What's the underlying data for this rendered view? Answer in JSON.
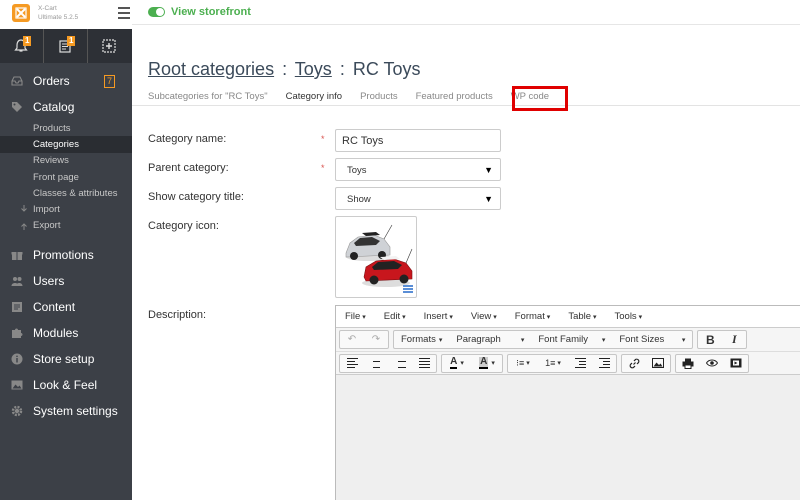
{
  "brand": {
    "line1": "X-Cart",
    "line2": "Ultimate 5.2.5"
  },
  "iconbar": {
    "notifications_badge": "1",
    "orders_badge": "1"
  },
  "topbar": {
    "storefront_label": "View storefront"
  },
  "sidebar": {
    "orders": {
      "label": "Orders",
      "count": "7"
    },
    "catalog": {
      "label": "Catalog"
    },
    "catalog_items": [
      "Products",
      "Categories",
      "Reviews",
      "Front page",
      "Classes & attributes",
      "Import",
      "Export"
    ],
    "sections": [
      "Promotions",
      "Users",
      "Content",
      "Modules",
      "Store setup",
      "Look & Feel",
      "System settings"
    ]
  },
  "breadcrumb": {
    "root": "Root categories",
    "sep1": ":",
    "toys": "Toys",
    "sep2": ":",
    "current": "RC Toys"
  },
  "tabs": [
    "Subcategories for \"RC Toys\"",
    "Category info",
    "Products",
    "Featured products",
    "WP code"
  ],
  "form": {
    "category_name_label": "Category name:",
    "category_name_value": "RC Toys",
    "required_mark": "*",
    "parent_category_label": "Parent category:",
    "parent_category_value": "Toys",
    "show_title_label": "Show category title:",
    "show_title_value": "Show",
    "category_icon_label": "Category icon:",
    "description_label": "Description:"
  },
  "editor": {
    "menu": [
      "File",
      "Edit",
      "Insert",
      "View",
      "Format",
      "Table",
      "Tools"
    ],
    "formats": "Formats",
    "paragraph": "Paragraph",
    "font_family": "Font Family",
    "font_sizes": "Font Sizes",
    "bold": "B",
    "italic": "I"
  },
  "colors": {
    "sidebar_bg": "#3c4047",
    "accent_orange": "#f59a23",
    "storefront_green": "#4caf50",
    "highlight_red": "#e00000"
  }
}
